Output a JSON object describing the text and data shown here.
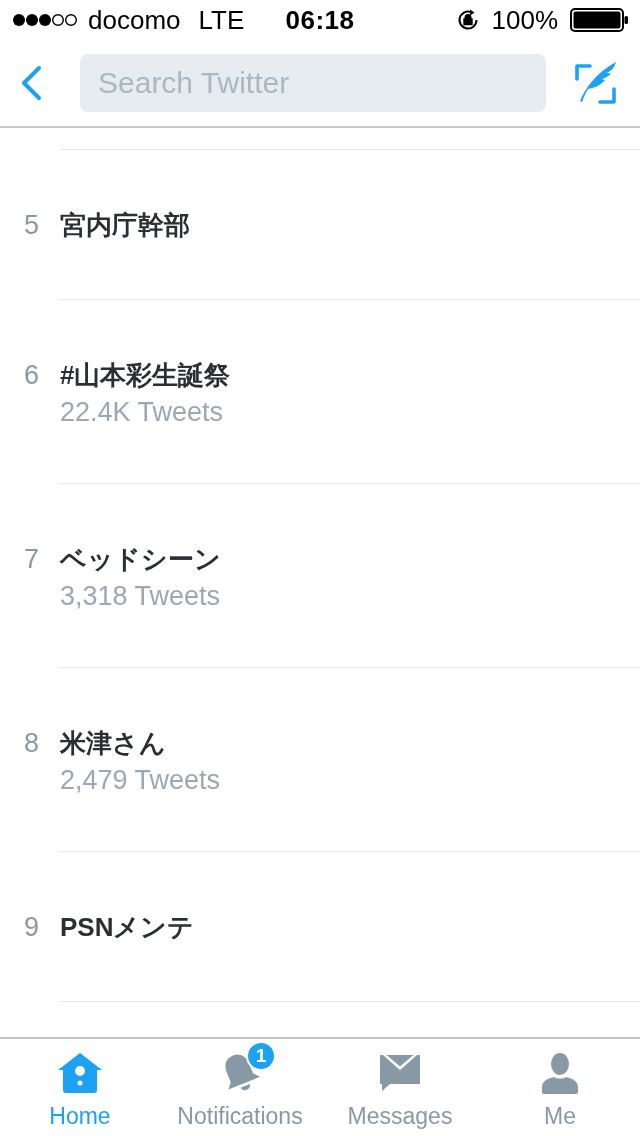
{
  "status_bar": {
    "carrier": "docomo",
    "network": "LTE",
    "time": "06:18",
    "battery": "100%"
  },
  "nav_bar": {
    "search": {
      "placeholder": "Search Twitter"
    }
  },
  "trends": [
    {
      "rank": "5",
      "name": "宮内庁幹部"
    },
    {
      "rank": "6",
      "name": "#山本彩生誕祭",
      "tweet_count": "22.4K Tweets"
    },
    {
      "rank": "7",
      "name": "ベッドシーン",
      "tweet_count": "3,318 Tweets"
    },
    {
      "rank": "8",
      "name": "米津さん",
      "tweet_count": "2,479 Tweets"
    },
    {
      "rank": "9",
      "name": "PSNメンテ"
    }
  ],
  "tab_bar": {
    "tabs": [
      {
        "kind": "home",
        "label": "Home",
        "selected": true
      },
      {
        "kind": "notifications",
        "label": "Notifications",
        "selected": false,
        "badge": "1"
      },
      {
        "kind": "messages",
        "label": "Messages",
        "selected": false
      },
      {
        "kind": "me",
        "label": "Me",
        "selected": false
      }
    ]
  }
}
